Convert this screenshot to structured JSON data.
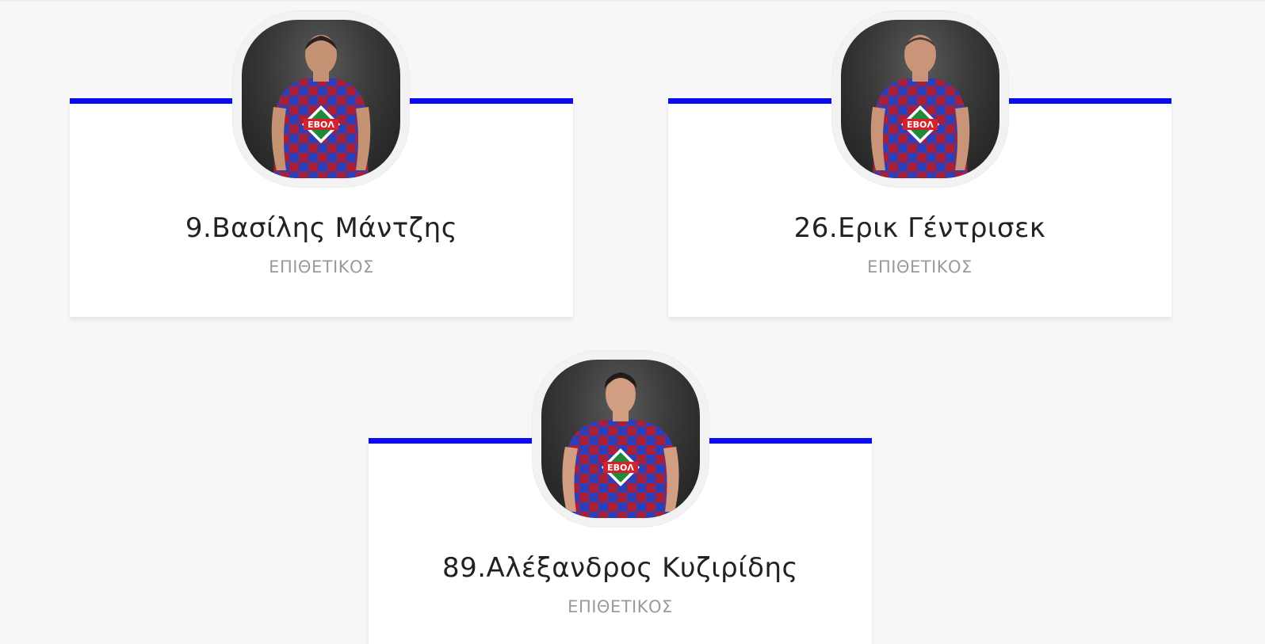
{
  "players": [
    {
      "name": "9.Βασίλης Μάντζης",
      "position": "ΕΠΙΘΕΤΙΚΟΣ",
      "sponsor": "ΕΒΟΛ"
    },
    {
      "name": "26.Ερικ Γέντρισεκ",
      "position": "ΕΠΙΘΕΤΙΚΟΣ",
      "sponsor": "ΕΒΟΛ"
    },
    {
      "name": "89.Αλέξανδρος Κυζιρίδης",
      "position": "ΕΠΙΘΕΤΙΚΟΣ",
      "sponsor": "ΕΒΟΛ"
    }
  ],
  "colors": {
    "accent": "#0b0bef",
    "background": "#f7f7f7",
    "card": "#ffffff",
    "name_text": "#222222",
    "position_text": "#9a9a9a",
    "jersey_blue": "#2d3fb8",
    "jersey_red": "#a81f38"
  }
}
